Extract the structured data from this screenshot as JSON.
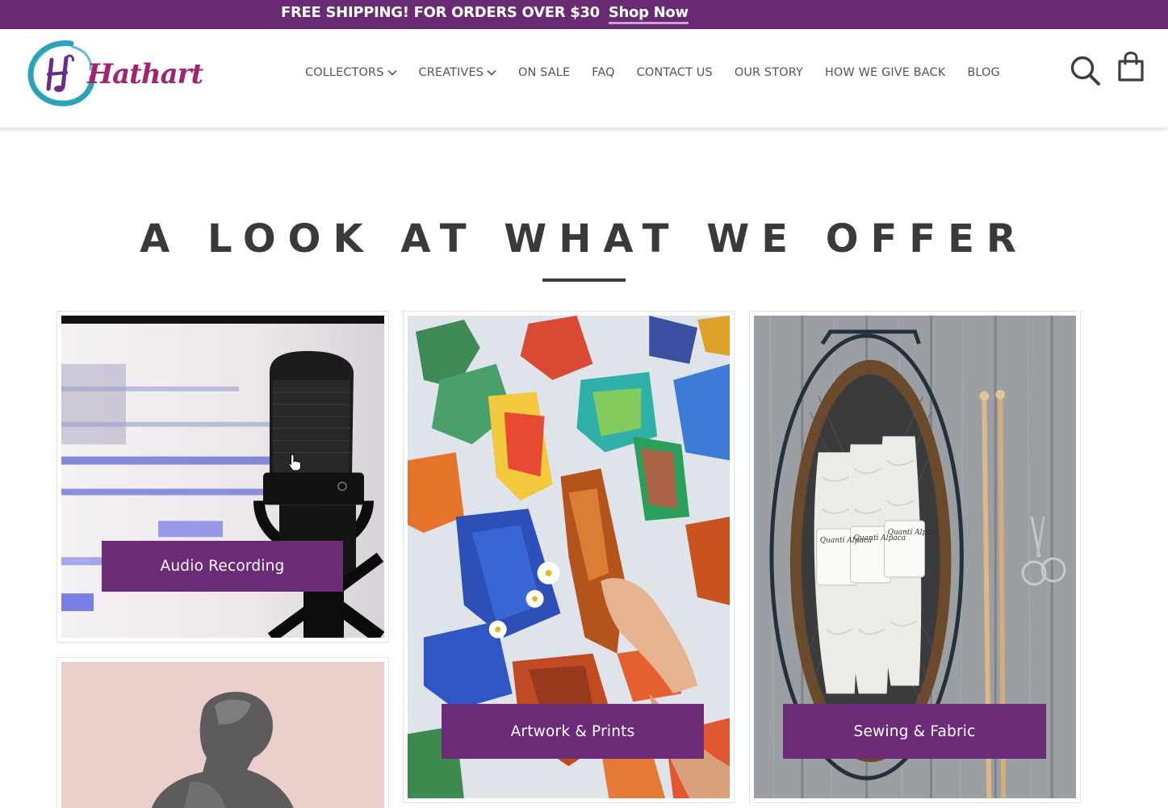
{
  "announcement": {
    "text": "FREE SHIPPING! FOR ORDERS OVER $30",
    "link_label": "Shop Now"
  },
  "brand": {
    "logo_text": "Hathart",
    "logo_letter": "H",
    "colors": {
      "purple": "#682a73",
      "teal": "#2aa3b8",
      "pink": "#c0328a"
    }
  },
  "nav": {
    "items": [
      {
        "label": "COLLECTORS",
        "dropdown": true
      },
      {
        "label": "CREATIVES",
        "dropdown": true
      },
      {
        "label": "ON SALE",
        "dropdown": false
      },
      {
        "label": "FAQ",
        "dropdown": false
      },
      {
        "label": "CONTACT US",
        "dropdown": false
      },
      {
        "label": "OUR STORY",
        "dropdown": false
      },
      {
        "label": "HOW WE GIVE BACK",
        "dropdown": false
      },
      {
        "label": "BLOG",
        "dropdown": false
      }
    ],
    "icons": [
      "search-icon",
      "shopping-bag-icon"
    ]
  },
  "section": {
    "title": "A LOOK AT WHAT WE OFFER"
  },
  "cards": [
    {
      "label": "Audio Recording"
    },
    {
      "label": "Artwork & Prints"
    },
    {
      "label": "Sewing & Fabric"
    },
    {
      "label": ""
    }
  ],
  "yarn_labels": [
    "Quanti Alpaca",
    "Quanti Alpaca",
    "Quanti Alpaca"
  ]
}
